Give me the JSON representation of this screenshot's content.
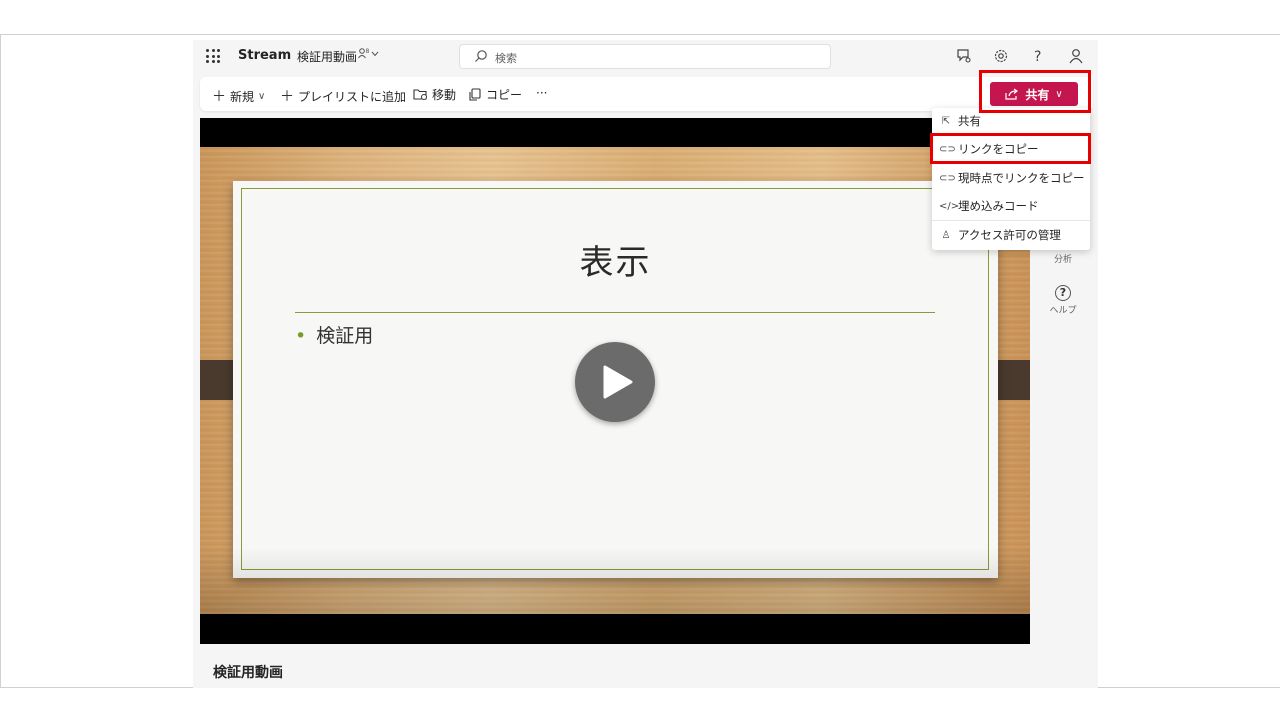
{
  "topbar": {
    "app_name": "Stream",
    "doc_name": "検証用動画",
    "search_placeholder": "検索"
  },
  "commandbar": {
    "new_label": "新規",
    "add_playlist_label": "プレイリストに追加",
    "move_label": "移動",
    "copy_label": "コピー",
    "more_label": "···"
  },
  "share_button": {
    "label": "共有"
  },
  "slide": {
    "title": "表示",
    "bullet": "検証用"
  },
  "video_title": "検証用動画",
  "rail": {
    "analytics_label": "分析",
    "help_label": "ヘルプ"
  },
  "share_menu": {
    "items": [
      {
        "label": "共有",
        "icon": "share-icon"
      },
      {
        "label": "リンクをコピー",
        "icon": "link-icon"
      },
      {
        "label": "現時点でリンクをコピー",
        "icon": "link-time-icon"
      },
      {
        "label": "埋め込みコード",
        "icon": "embed-icon"
      },
      {
        "label": "アクセス許可の管理",
        "icon": "manage-access-icon"
      }
    ]
  },
  "colors": {
    "share_button": "#c4154f",
    "highlight_box": "#e60000",
    "accent_green": "#8a9a3a"
  }
}
